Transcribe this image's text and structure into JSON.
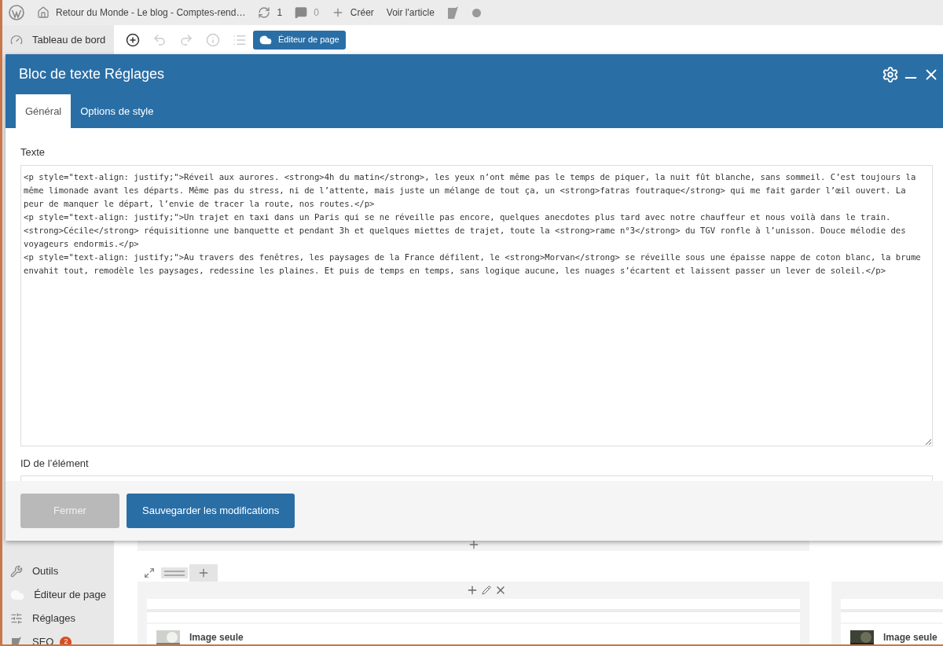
{
  "admin_bar": {
    "site_title": "Retour du Monde - Le blog - Comptes-rend…",
    "updates": "1",
    "comments": "0",
    "new": "Créer",
    "view": "Voir l'article"
  },
  "sidebar": {
    "top_items": [
      {
        "label": "Tableau de bord",
        "kind": "dashboard"
      }
    ],
    "bottom_items": [
      {
        "label": "Outils",
        "kind": "tools"
      },
      {
        "label": "Éditeur de page",
        "kind": "builder"
      },
      {
        "label": "Réglages",
        "kind": "settings"
      },
      {
        "label": "SEO",
        "kind": "seo",
        "badge": "2"
      }
    ]
  },
  "toolbar": {
    "editor_button": "Éditeur de page"
  },
  "modal": {
    "title": "Bloc de texte Réglages",
    "tabs": [
      {
        "label": "Général",
        "selected": true
      },
      {
        "label": "Options de style",
        "selected": false
      }
    ],
    "fields": [
      {
        "kind": "textarea",
        "label": "Texte",
        "value": [
          "<p style=\"text-align: justify;\">Réveil aux aurores. <strong>4h du matin</strong>, les yeux n’ont même pas le temps de piquer, la nuit fût blanche, sans sommeil. C’est toujours la même limonade avant les départs. Même pas du stress, ni de l’attente, mais juste un mélange de tout ça, un <strong>fatras foutraque</strong> qui me fait garder l’œil ouvert. La peur de manquer le départ, l’envie de tracer la route, nos routes.</p>",
          "<p style=\"text-align: justify;\">Un trajet en taxi dans un Paris qui se ne réveille pas encore, quelques anecdotes plus tard avec notre chauffeur et nous voilà dans le train. <strong>Cécile</strong> réquisitionne une banquette et pendant 3h et quelques miettes de trajet, toute la <strong>rame n°3</strong> du TGV ronfle à l’unisson. Douce mélodie des voyageurs endormis.</p>",
          "<p style=\"text-align: justify;\">Au travers des fenêtres, les paysages de la France défilent, le <strong>Morvan</strong> se réveille sous une épaisse nappe de coton blanc, la brume envahit tout, remodèle les paysages, redessine les plaines. Et puis de temps en temps, sans logique aucune, les nuages s’écartent et laissent passer un lever de soleil.</p>"
        ]
      },
      {
        "kind": "input",
        "label": "ID de l’élément"
      }
    ],
    "buttons": [
      {
        "label": "Fermer",
        "kind": "secondary"
      },
      {
        "label": "Sauvegarder les modifications",
        "kind": "primary"
      }
    ]
  },
  "builder": {
    "modules": [
      {
        "title": "Image seule"
      },
      {
        "title": "Image seule"
      }
    ]
  }
}
